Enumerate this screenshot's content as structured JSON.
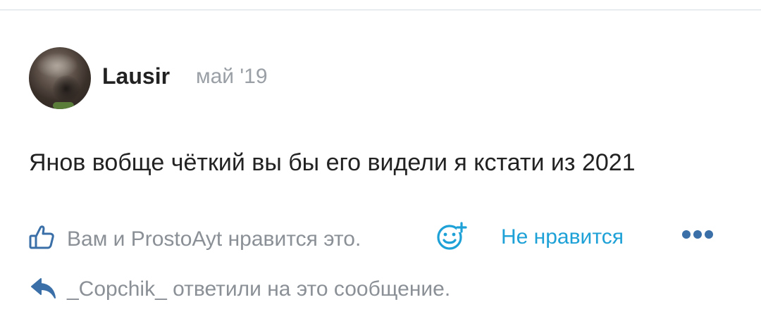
{
  "post": {
    "author": "Lausir",
    "date": "май '19",
    "message": "Янов вобще чёткий вы бы его видели я кстати из 2021"
  },
  "actions": {
    "likes_text": "Вам и ProstoAyt нравится это.",
    "dislike_label": "Не нравится",
    "reply_text": "_Copchik_ ответили на это сообщение."
  },
  "icons": {
    "like": "thumbs-up-icon",
    "react": "add-reaction-icon",
    "more": "more-dots-icon",
    "reply": "reply-arrow-icon"
  },
  "colors": {
    "text": "#222222",
    "muted": "#8a9096",
    "accent": "#1da1d6"
  }
}
